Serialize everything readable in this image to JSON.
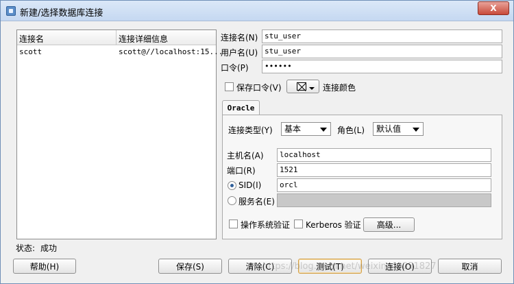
{
  "window": {
    "title": "新建/选择数据库连接",
    "close_label": "X"
  },
  "list": {
    "headers": [
      "连接名",
      "连接详细信息"
    ],
    "rows": [
      {
        "name": "scott",
        "details": "scott@//localhost:15..."
      }
    ]
  },
  "fields": {
    "conn_name_label": "连接名(N)",
    "conn_name_value": "stu_user",
    "username_label": "用户名(U)",
    "username_value": "stu_user",
    "password_label": "口令(P)",
    "password_value": "••••••",
    "save_password_label": "保存口令(V)",
    "conn_color_label": "连接颜色"
  },
  "tab": {
    "label": "Oracle"
  },
  "oracle": {
    "conn_type_label": "连接类型(Y)",
    "conn_type_value": "基本",
    "role_label": "角色(L)",
    "role_value": "默认值",
    "hostname_label": "主机名(A)",
    "hostname_value": "localhost",
    "port_label": "端口(R)",
    "port_value": "1521",
    "sid_label": "SID(I)",
    "sid_value": "orcl",
    "service_label": "服务名(E)",
    "service_value": "",
    "os_auth_label": "操作系统验证",
    "kerberos_label": "Kerberos 验证",
    "advanced_button": "高级..."
  },
  "status": {
    "label": "状态:",
    "value": "成功"
  },
  "buttons": {
    "help": "帮助(H)",
    "save": "保存(S)",
    "clear": "清除(C)",
    "test": "测试(T)",
    "connect": "连接(O)",
    "cancel": "取消"
  },
  "watermark": "https://blog.csdn.net/weixin_40051827"
}
